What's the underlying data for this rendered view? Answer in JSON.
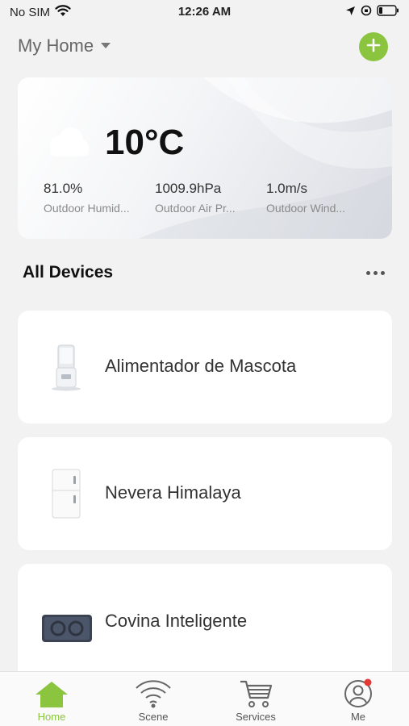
{
  "status_bar": {
    "carrier": "No SIM",
    "time": "12:26 AM"
  },
  "header": {
    "home_title": "My Home"
  },
  "weather": {
    "temperature": "10°C",
    "stats": [
      {
        "value": "81.0%",
        "label": "Outdoor Humid..."
      },
      {
        "value": "1009.9hPa",
        "label": "Outdoor Air Pr..."
      },
      {
        "value": "1.0m/s",
        "label": "Outdoor Wind..."
      }
    ]
  },
  "devices": {
    "title": "All Devices",
    "items": [
      {
        "name": "Alimentador de Mascota",
        "icon": "pet-feeder-image"
      },
      {
        "name": "Nevera Himalaya",
        "icon": "fridge-image"
      },
      {
        "name": "Covina Inteligente",
        "icon": "smart-device-image"
      }
    ]
  },
  "tabs": [
    {
      "label": "Home",
      "icon": "home-icon",
      "active": true
    },
    {
      "label": "Scene",
      "icon": "scene-icon",
      "active": false
    },
    {
      "label": "Services",
      "icon": "cart-icon",
      "active": false
    },
    {
      "label": "Me",
      "icon": "profile-icon",
      "active": false,
      "badge": true
    }
  ],
  "colors": {
    "accent": "#8bc53f",
    "background": "#f2f2f2",
    "badge": "#e53935"
  }
}
